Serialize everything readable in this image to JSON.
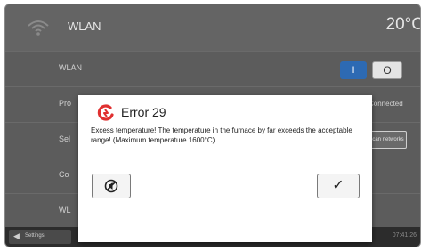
{
  "header": {
    "title": "WLAN",
    "temperature": "20°C",
    "icon": "wifi-icon"
  },
  "rows": [
    {
      "label": "WLAN",
      "toggle_on": "I",
      "toggle_off": "O"
    },
    {
      "label": "Pro",
      "status": "Connected"
    },
    {
      "label": "Sel",
      "button": "Scan networks"
    },
    {
      "label": "Co"
    },
    {
      "label": "WL"
    }
  ],
  "footer": {
    "back_label": "Settings",
    "time": "07:41:26"
  },
  "dialog": {
    "title": "Error 29",
    "message": "Excess temperature! The temperature in the furnace by far exceeds the acceptable range! (Maximum temperature 1600°C)",
    "confirm_label": "✓",
    "accent_color": "#e03030"
  }
}
